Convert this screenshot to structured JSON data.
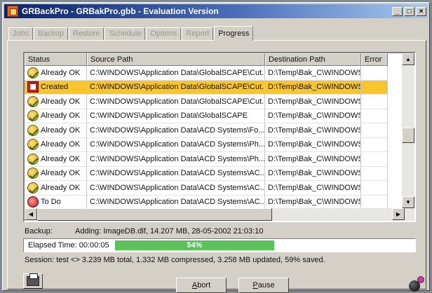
{
  "window": {
    "title": "GRBackPro - GRBakPro.gbb - Evaluation Version",
    "minimize_glyph": "_",
    "maximize_glyph": "□",
    "close_glyph": "×"
  },
  "tabs": [
    {
      "label": "Jobs"
    },
    {
      "label": "Backup"
    },
    {
      "label": "Restore"
    },
    {
      "label": "Schedule"
    },
    {
      "label": "Options"
    },
    {
      "label": "Report"
    },
    {
      "label": "Progress"
    }
  ],
  "grid": {
    "headers": {
      "status": "Status",
      "source": "Source Path",
      "destination": "Destination Path",
      "error": "Error"
    },
    "rows": [
      {
        "status": "Already OK",
        "icon": "ok-icon",
        "source": "C:\\WINDOWS\\Application Data\\GlobalSCAPE\\Cut...",
        "destination": "D:\\Temp\\Bak_C\\WINDOWS\\App...",
        "error": ""
      },
      {
        "status": "Created",
        "icon": "created-icon",
        "source": "C:\\WINDOWS\\Application Data\\GlobalSCAPE\\Cut...",
        "destination": "D:\\Temp\\Bak_C\\WINDOWS\\App...",
        "error": ""
      },
      {
        "status": "Already OK",
        "icon": "ok-icon",
        "source": "C:\\WINDOWS\\Application Data\\GlobalSCAPE\\Cut...",
        "destination": "D:\\Temp\\Bak_C\\WINDOWS\\App...",
        "error": ""
      },
      {
        "status": "Already OK",
        "icon": "ok-icon",
        "source": "C:\\WINDOWS\\Application Data\\GlobalSCAPE",
        "destination": "D:\\Temp\\Bak_C\\WINDOWS\\App...",
        "error": ""
      },
      {
        "status": "Already OK",
        "icon": "ok-icon",
        "source": "C:\\WINDOWS\\Application Data\\ACD Systems\\Fo...",
        "destination": "D:\\Temp\\Bak_C\\WINDOWS\\App...",
        "error": ""
      },
      {
        "status": "Already OK",
        "icon": "ok-icon",
        "source": "C:\\WINDOWS\\Application Data\\ACD Systems\\Ph...",
        "destination": "D:\\Temp\\Bak_C\\WINDOWS\\App...",
        "error": ""
      },
      {
        "status": "Already OK",
        "icon": "ok-icon",
        "source": "C:\\WINDOWS\\Application Data\\ACD Systems\\Ph...",
        "destination": "D:\\Temp\\Bak_C\\WINDOWS\\App...",
        "error": ""
      },
      {
        "status": "Already OK",
        "icon": "ok-icon",
        "source": "C:\\WINDOWS\\Application Data\\ACD Systems\\AC...",
        "destination": "D:\\Temp\\Bak_C\\WINDOWS\\App...",
        "error": ""
      },
      {
        "status": "Already OK",
        "icon": "ok-icon",
        "source": "C:\\WINDOWS\\Application Data\\ACD Systems\\AC...",
        "destination": "D:\\Temp\\Bak_C\\WINDOWS\\App...",
        "error": ""
      },
      {
        "status": "To Do",
        "icon": "todo-icon",
        "source": "C:\\WINDOWS\\Application Data\\ACD Systems\\AC...",
        "destination": "D:\\Temp\\Bak_C\\WINDOWS\\App...",
        "error": ""
      }
    ],
    "selected_row": 1,
    "selected_color": "#f8c430"
  },
  "status": {
    "backup_label": "Backup:",
    "backup_text": "Adding: ImageDB.dlf, 14.207 MB, 28-05-2002 21:03:10",
    "elapsed_label": "Elapsed Time: 00:00:05",
    "progress_percent": 54,
    "progress_text": "54%",
    "progress_color": "#5cc35a",
    "session_text": "Session: test <> 3.239 MB total, 1.332 MB compressed, 3.258 MB updated, 59% saved."
  },
  "buttons": {
    "abort_label": "Abort",
    "abort_accel": "A",
    "pause_label": "Pause",
    "pause_accel": "P"
  }
}
